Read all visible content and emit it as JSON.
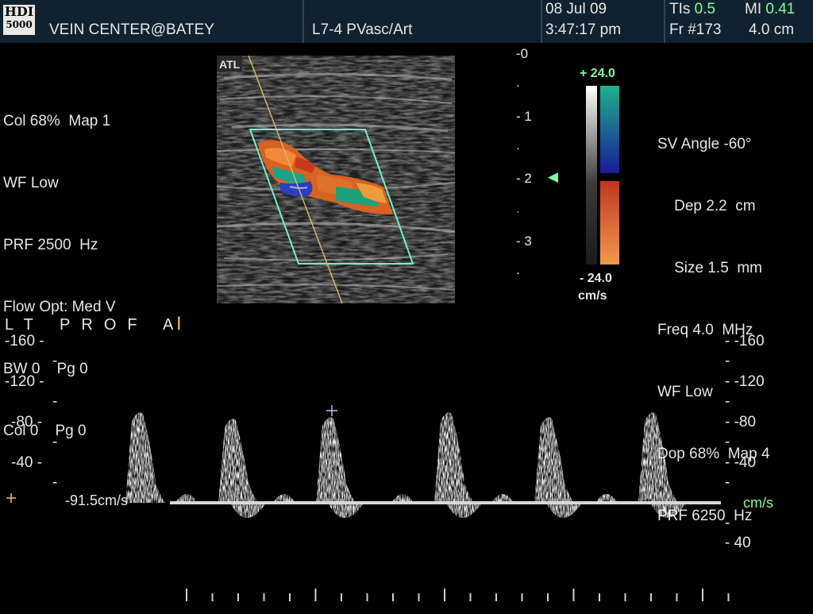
{
  "header": {
    "logo_top": "HDI",
    "logo_bottom": "5000",
    "site": "VEIN CENTER@BATEY",
    "probe": "L7-4 PVasc/Art",
    "date": "08 Jul 09",
    "time": "3:47:17 pm",
    "tis_label": "TIs",
    "tis_value": "0.5",
    "mi_label": "MI",
    "mi_value": "0.41",
    "frame": "Fr #173",
    "depth": "4.0 cm"
  },
  "color_params": {
    "line1": "Col 68%  Map 1",
    "line2": "WF Low",
    "line3": "PRF 2500  Hz",
    "line4": "Flow Opt: Med V",
    "line5": "BW 0    Pg 0",
    "line6": "Col 0    Pg 0"
  },
  "image": {
    "logo": "ATL"
  },
  "depth_scale": [
    "0",
    "1",
    "2",
    "3"
  ],
  "color_bar": {
    "top": "+ 24.0",
    "bottom": "- 24.0",
    "unit": "cm/s",
    "colors": {
      "pos_top": "#1db38a",
      "pos_bottom": "#1a1a9a",
      "neg_top": "#c1361f",
      "neg_bottom": "#f19a4c"
    }
  },
  "doppler_params": {
    "line1": "SV Angle -60°",
    "line2": "    Dep 2.2  cm",
    "line3": "    Size 1.5  mm",
    "line4": "Freq 4.0  MHz",
    "line5": "WF Low",
    "line6": "Dop 68%  Map 4",
    "line7": "PRF 6250  Hz"
  },
  "spectral": {
    "label": "LT PROF A",
    "velocity_readout": "-91.5cm/s",
    "unit": "cm/s",
    "left_scale": [
      "-160",
      "-120",
      "-80",
      "-40"
    ],
    "right_scale": [
      "-160",
      "-120",
      "-80",
      "-40",
      "40"
    ]
  }
}
